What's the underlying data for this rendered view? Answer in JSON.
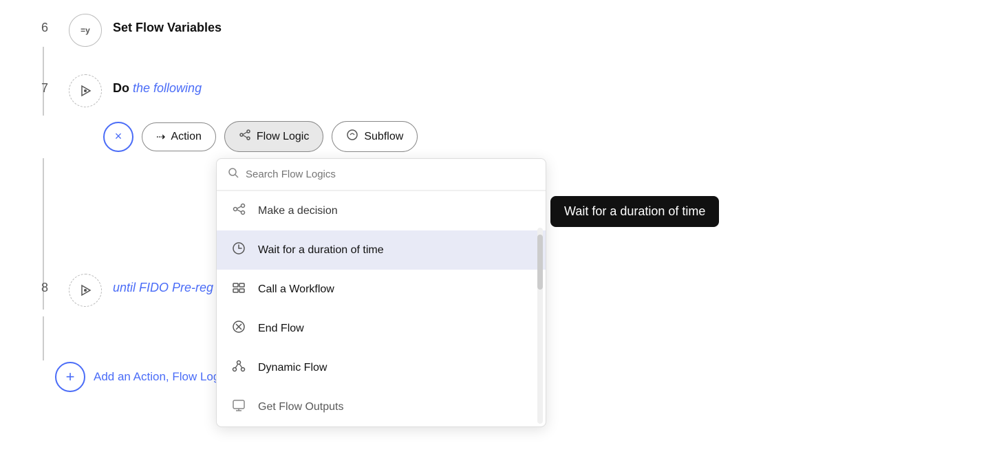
{
  "steps": [
    {
      "number": "6",
      "icon_label": "=y",
      "title": "Set Flow Variables",
      "title_style": "bold"
    },
    {
      "number": "7",
      "icon_label": "▶",
      "title_prefix": "Do",
      "title_suffix": "the following",
      "title_style": "mixed"
    },
    {
      "number": "8",
      "icon_label": "▶",
      "title_text": "until FIDO Pre-reg response",
      "title_style": "link"
    }
  ],
  "toolbar": {
    "close_label": "×",
    "buttons": [
      {
        "id": "action",
        "icon": "⇢",
        "label": "Action"
      },
      {
        "id": "flow-logic",
        "icon": "⋈",
        "label": "Flow Logic",
        "active": true
      },
      {
        "id": "subflow",
        "icon": "⌁",
        "label": "Subflow"
      }
    ]
  },
  "search": {
    "placeholder": "Search Flow Logics"
  },
  "dropdown_items": [
    {
      "id": "make-decision",
      "icon": "⋈",
      "label": "Make a decision",
      "partial_top": true
    },
    {
      "id": "wait-duration",
      "icon": "⊙",
      "label": "Wait for a duration of time",
      "highlighted": true
    },
    {
      "id": "call-workflow",
      "icon": "⊞",
      "label": "Call a Workflow"
    },
    {
      "id": "end-flow",
      "icon": "⊗",
      "label": "End Flow"
    },
    {
      "id": "dynamic-flow",
      "icon": "⋏",
      "label": "Dynamic Flow"
    },
    {
      "id": "get-flow-outputs",
      "icon": "⌥",
      "label": "Get Flow Outputs",
      "partial_bottom": true
    }
  ],
  "tooltip": {
    "text": "Wait for a duration of time"
  },
  "add_row": {
    "label": "Add an Action, Flow Logic, o..."
  }
}
